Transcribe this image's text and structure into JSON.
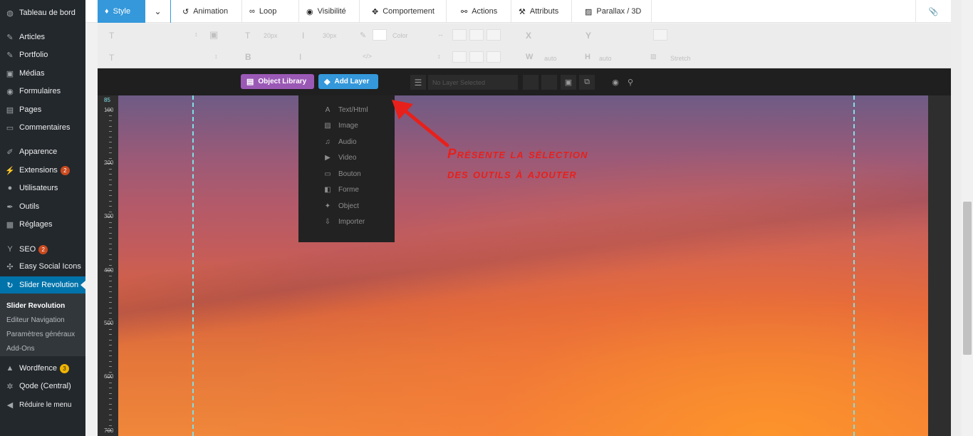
{
  "sidebar": {
    "items": [
      {
        "label": "Tableau de bord",
        "icon": "dashboard-icon",
        "glyph": "◍"
      },
      {
        "label": "Articles",
        "icon": "pin-icon",
        "glyph": "✎"
      },
      {
        "label": "Portfolio",
        "icon": "pin-icon",
        "glyph": "✎"
      },
      {
        "label": "Médias",
        "icon": "media-icon",
        "glyph": "▣"
      },
      {
        "label": "Formulaires",
        "icon": "forms-icon",
        "glyph": "◉"
      },
      {
        "label": "Pages",
        "icon": "page-icon",
        "glyph": "▤"
      },
      {
        "label": "Commentaires",
        "icon": "comment-icon",
        "glyph": "▭"
      },
      {
        "label": "Apparence",
        "icon": "brush-icon",
        "glyph": "✐"
      },
      {
        "label": "Extensions",
        "icon": "plugin-icon",
        "glyph": "⚡",
        "badge": "2"
      },
      {
        "label": "Utilisateurs",
        "icon": "user-icon",
        "glyph": "●"
      },
      {
        "label": "Outils",
        "icon": "wrench-icon",
        "glyph": "✒"
      },
      {
        "label": "Réglages",
        "icon": "settings-icon",
        "glyph": "▦"
      },
      {
        "label": "SEO",
        "icon": "seo-icon",
        "glyph": "Y",
        "badge": "2"
      },
      {
        "label": "Easy Social Icons",
        "icon": "social-icon",
        "glyph": "✣"
      },
      {
        "label": "Slider Revolution",
        "icon": "revolution-icon",
        "glyph": "↻"
      }
    ],
    "submenu": [
      "Slider Revolution",
      "Editeur Navigation",
      "Paramètres généraux",
      "Add-Ons"
    ],
    "bottom_items": [
      {
        "label": "Wordfence",
        "icon": "wordfence-icon",
        "glyph": "▲",
        "badge": "3"
      },
      {
        "label": "Qode (Central)",
        "icon": "gear-icon",
        "glyph": "✲"
      },
      {
        "label": "Réduire le menu",
        "icon": "collapse-icon",
        "glyph": "◀"
      }
    ]
  },
  "tabs": [
    {
      "label": "Style",
      "icon": "drop-icon",
      "glyph": "♦"
    },
    {
      "label": "Animation",
      "icon": "history-icon",
      "glyph": "↺"
    },
    {
      "label": "Loop",
      "icon": "loop-icon",
      "glyph": "∞"
    },
    {
      "label": "Visibilité",
      "icon": "eye-icon",
      "glyph": "◉"
    },
    {
      "label": "Comportement",
      "icon": "move-icon",
      "glyph": "✥"
    },
    {
      "label": "Actions",
      "icon": "link-icon",
      "glyph": "⚯"
    },
    {
      "label": "Attributs",
      "icon": "tools-icon",
      "glyph": "⚒"
    },
    {
      "label": "Parallax / 3D",
      "icon": "image-icon",
      "glyph": "▨"
    }
  ],
  "props": {
    "font_size": "20px",
    "line_height": "30px",
    "color_label": "Color",
    "x_label": "X",
    "y_label": "Y",
    "w_label": "W",
    "h_label": "H",
    "dim_1": "auto",
    "dim_2": "auto",
    "stretch": "Stretch"
  },
  "toolbar": {
    "object_library": "Object Library",
    "add_layer": "Add Layer",
    "no_layer": "No Layer Selected"
  },
  "dropdown": [
    {
      "label": "Text/Html",
      "icon": "text-icon",
      "glyph": "A"
    },
    {
      "label": "Image",
      "icon": "image-icon",
      "glyph": "▨"
    },
    {
      "label": "Audio",
      "icon": "music-icon",
      "glyph": "♫"
    },
    {
      "label": "Video",
      "icon": "video-icon",
      "glyph": "▶"
    },
    {
      "label": "Bouton",
      "icon": "button-icon",
      "glyph": "▭"
    },
    {
      "label": "Forme",
      "icon": "shape-icon",
      "glyph": "◧"
    },
    {
      "label": "Object",
      "icon": "object-icon",
      "glyph": "✦"
    },
    {
      "label": "Importer",
      "icon": "import-icon",
      "glyph": "⇩"
    }
  ],
  "ruler": {
    "start": "85",
    "labels": [
      "100",
      "200",
      "300",
      "400",
      "500",
      "600",
      "700"
    ]
  },
  "annotation": {
    "line1": "Présente la sélection",
    "line2": "des outils à ajouter",
    "color": "#e8201b"
  },
  "colors": {
    "wp_blue": "#0073aa",
    "tab_active": "#3498db",
    "purple": "#9b59b6",
    "sidebar_bg": "#23282d"
  }
}
